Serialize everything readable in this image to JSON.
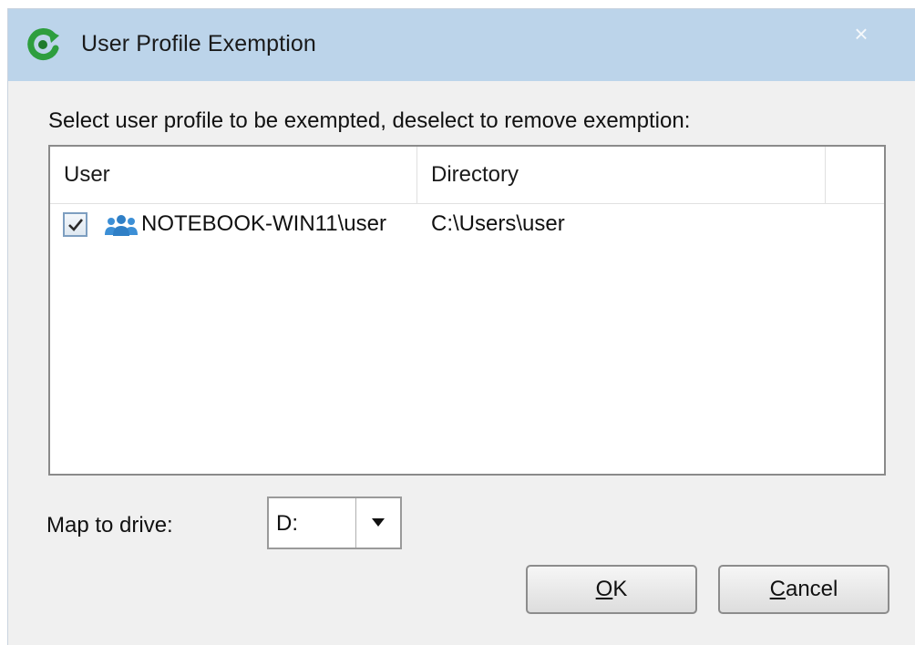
{
  "window": {
    "title": "User Profile Exemption",
    "close_symbol": "×"
  },
  "instruction": "Select user profile to be exempted, deselect to remove exemption:",
  "list": {
    "columns": [
      "User",
      "Directory",
      ""
    ],
    "rows": [
      {
        "checked": true,
        "icon": "users-icon",
        "user": "NOTEBOOK-WIN11\\user",
        "directory": "C:\\Users\\user"
      }
    ]
  },
  "drive": {
    "label": "Map to drive:",
    "selected": "D:"
  },
  "buttons": {
    "ok_mnemonic": "O",
    "ok_rest": "K",
    "cancel_mnemonic": "C",
    "cancel_rest": "ancel"
  },
  "colors": {
    "titlebar": "#bcd4ea",
    "dialog_bg": "#f0f0f0",
    "icon_green": "#2e9e3e",
    "users_icon_blue": "#3c8fd6"
  }
}
